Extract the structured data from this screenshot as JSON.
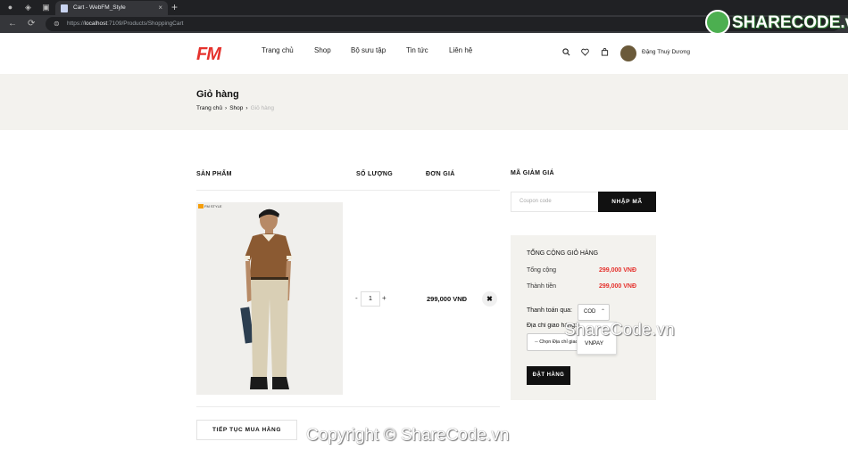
{
  "browser": {
    "tab_title": "Cart - WebFM_Style",
    "tab_close": "×",
    "new_tab": "+",
    "url_host": "localhost",
    "url_prefix": "https://",
    "url_rest": ":7109/Products/ShoppingCart",
    "back": "←",
    "reload": "⟳"
  },
  "watermark_logo": {
    "text": "SHARECODE.vn"
  },
  "site": {
    "logo": "FM",
    "menu": [
      "Trang chủ",
      "Shop",
      "Bộ sưu tập",
      "Tin tức",
      "Liên hệ"
    ],
    "user_name": "Đặng Thuỳ Dương"
  },
  "hero": {
    "title": "Giỏ hàng",
    "breadcrumb": [
      "Trang chủ",
      "Shop",
      "Giỏ hàng"
    ],
    "sep": "›"
  },
  "cart": {
    "columns": [
      "SẢN PHẨM",
      "SỐ LƯỢNG",
      "ĐƠN GIÁ"
    ],
    "item": {
      "badge": "FM STYLE",
      "quantity": "1",
      "minus": "-",
      "plus": "+",
      "price": "299,000 VNĐ",
      "remove": "✖"
    },
    "continue_label": "TIẾP TỤC MUA HÀNG"
  },
  "coupon": {
    "title": "MÃ GIẢM GIÁ",
    "placeholder": "Coupon code",
    "button": "NHẬP MÃ"
  },
  "totals": {
    "title": "TỔNG CỘNG GIỎ HÀNG",
    "subtotal_label": "Tổng cộng",
    "subtotal_value": "299,000 VNĐ",
    "total_label": "Thành tiền",
    "total_value": "299,000 VNĐ",
    "payment_label": "Thanh toán qua:",
    "payment_selected": "COD",
    "payment_options": [
      "VNPAY"
    ],
    "address_label": "Địa chỉ giao hàng:",
    "address_placeholder": "-- Chọn Địa chỉ giao hàng --",
    "order_button": "ĐẶT HÀNG"
  },
  "watermarks": {
    "mid": "ShareCode.vn",
    "bottom": "Copyright © ShareCode.vn"
  },
  "colors": {
    "brand_red": "#e5322d",
    "dark": "#111111",
    "panel": "#f3f2ee"
  }
}
